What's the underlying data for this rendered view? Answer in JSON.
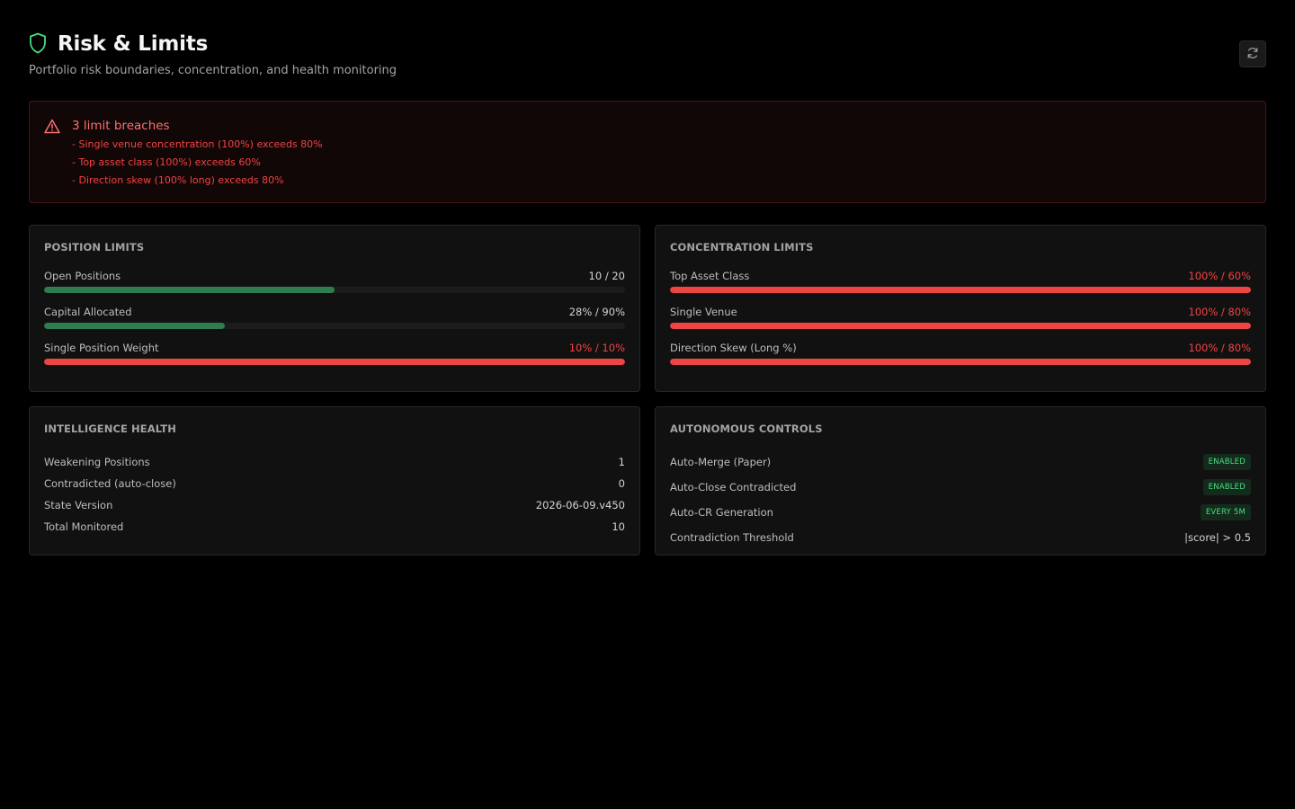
{
  "header": {
    "title": "Risk & Limits",
    "subtitle": "Portfolio risk boundaries, concentration, and health monitoring"
  },
  "alert": {
    "title": "3 limit breaches",
    "items": [
      "- Single venue concentration (100%) exceeds 80%",
      "- Top asset class (100%) exceeds 60%",
      "- Direction skew (100% long) exceeds 80%"
    ]
  },
  "position_limits": {
    "title": "POSITION LIMITS",
    "meters": [
      {
        "label": "Open Positions",
        "value": "10 / 20",
        "fill_fraction": 0.5,
        "breach": false
      },
      {
        "label": "Capital Allocated",
        "value": "28% / 90%",
        "fill_fraction": 0.311,
        "breach": false
      },
      {
        "label": "Single Position Weight",
        "value": "10% / 10%",
        "fill_fraction": 1.0,
        "breach": true
      }
    ]
  },
  "concentration_limits": {
    "title": "CONCENTRATION LIMITS",
    "meters": [
      {
        "label": "Top Asset Class",
        "value": "100% / 60%",
        "fill_fraction": 1.0,
        "breach": true
      },
      {
        "label": "Single Venue",
        "value": "100% / 80%",
        "fill_fraction": 1.0,
        "breach": true
      },
      {
        "label": "Direction Skew (Long %)",
        "value": "100% / 80%",
        "fill_fraction": 1.0,
        "breach": true
      }
    ]
  },
  "intelligence_health": {
    "title": "INTELLIGENCE HEALTH",
    "rows": [
      {
        "label": "Weakening Positions",
        "value": "1"
      },
      {
        "label": "Contradicted (auto-close)",
        "value": "0"
      },
      {
        "label": "State Version",
        "value": "2026-06-09.v450"
      },
      {
        "label": "Total Monitored",
        "value": "10"
      }
    ]
  },
  "autonomous_controls": {
    "title": "AUTONOMOUS CONTROLS",
    "rows": [
      {
        "label": "Auto-Merge (Paper)",
        "badge": "ENABLED"
      },
      {
        "label": "Auto-Close Contradicted",
        "badge": "ENABLED"
      },
      {
        "label": "Auto-CR Generation",
        "badge": "EVERY 5M"
      },
      {
        "label": "Contradiction Threshold",
        "value": "|score| > 0.5"
      }
    ]
  },
  "colors": {
    "ok": "#2f7d4f",
    "breach": "#ef4444",
    "accent_icon": "#4ade80"
  },
  "icons": {
    "title": "shield-icon",
    "alert": "warning-triangle-icon",
    "refresh": "refresh-icon"
  }
}
